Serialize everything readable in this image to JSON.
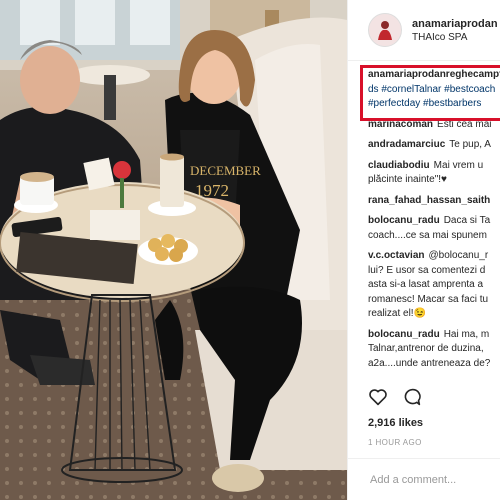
{
  "header": {
    "username": "anamariaprodan",
    "location": "THAIco SPA"
  },
  "caption": {
    "username": "anamariaprodanreghecampf",
    "line2": "ds #cornelTalnar #bestcoach",
    "line3": "#perfectday #bestbarbers"
  },
  "comments": [
    {
      "user": "marinacoman",
      "lines": [
        "Esti cea mai"
      ]
    },
    {
      "user": "andradamarciuc",
      "lines": [
        "Te pup, A"
      ]
    },
    {
      "user": "claudiabodiu",
      "lines": [
        "Mai vrem u",
        "plăcinte inainte\"!♥"
      ]
    },
    {
      "user": "rana_fahad_hassan_saith",
      "lines": []
    },
    {
      "user": "bolocanu_radu",
      "lines": [
        "Daca si Ta",
        "coach....ce sa mai spunem"
      ]
    },
    {
      "user": "v.c.octavian",
      "lines": [
        "@bolocanu_r",
        "lui? E usor sa comentezi d",
        "asta si-a lasat amprenta a",
        "romanesc! Macar sa faci tu",
        "realizat el!😉"
      ]
    },
    {
      "user": "bolocanu_radu",
      "lines": [
        "Hai ma, m",
        "Talnar,antrenor de duzina,",
        "a2a....unde antreneaza de?"
      ]
    }
  ],
  "likes": "2,916 likes",
  "time": "1 HOUR AGO",
  "add_comment_placeholder": "Add a comment...",
  "colors": {
    "highlight": "#d8102a",
    "hashtag": "#003569"
  },
  "icons": [
    "heart-icon",
    "comment-icon"
  ]
}
